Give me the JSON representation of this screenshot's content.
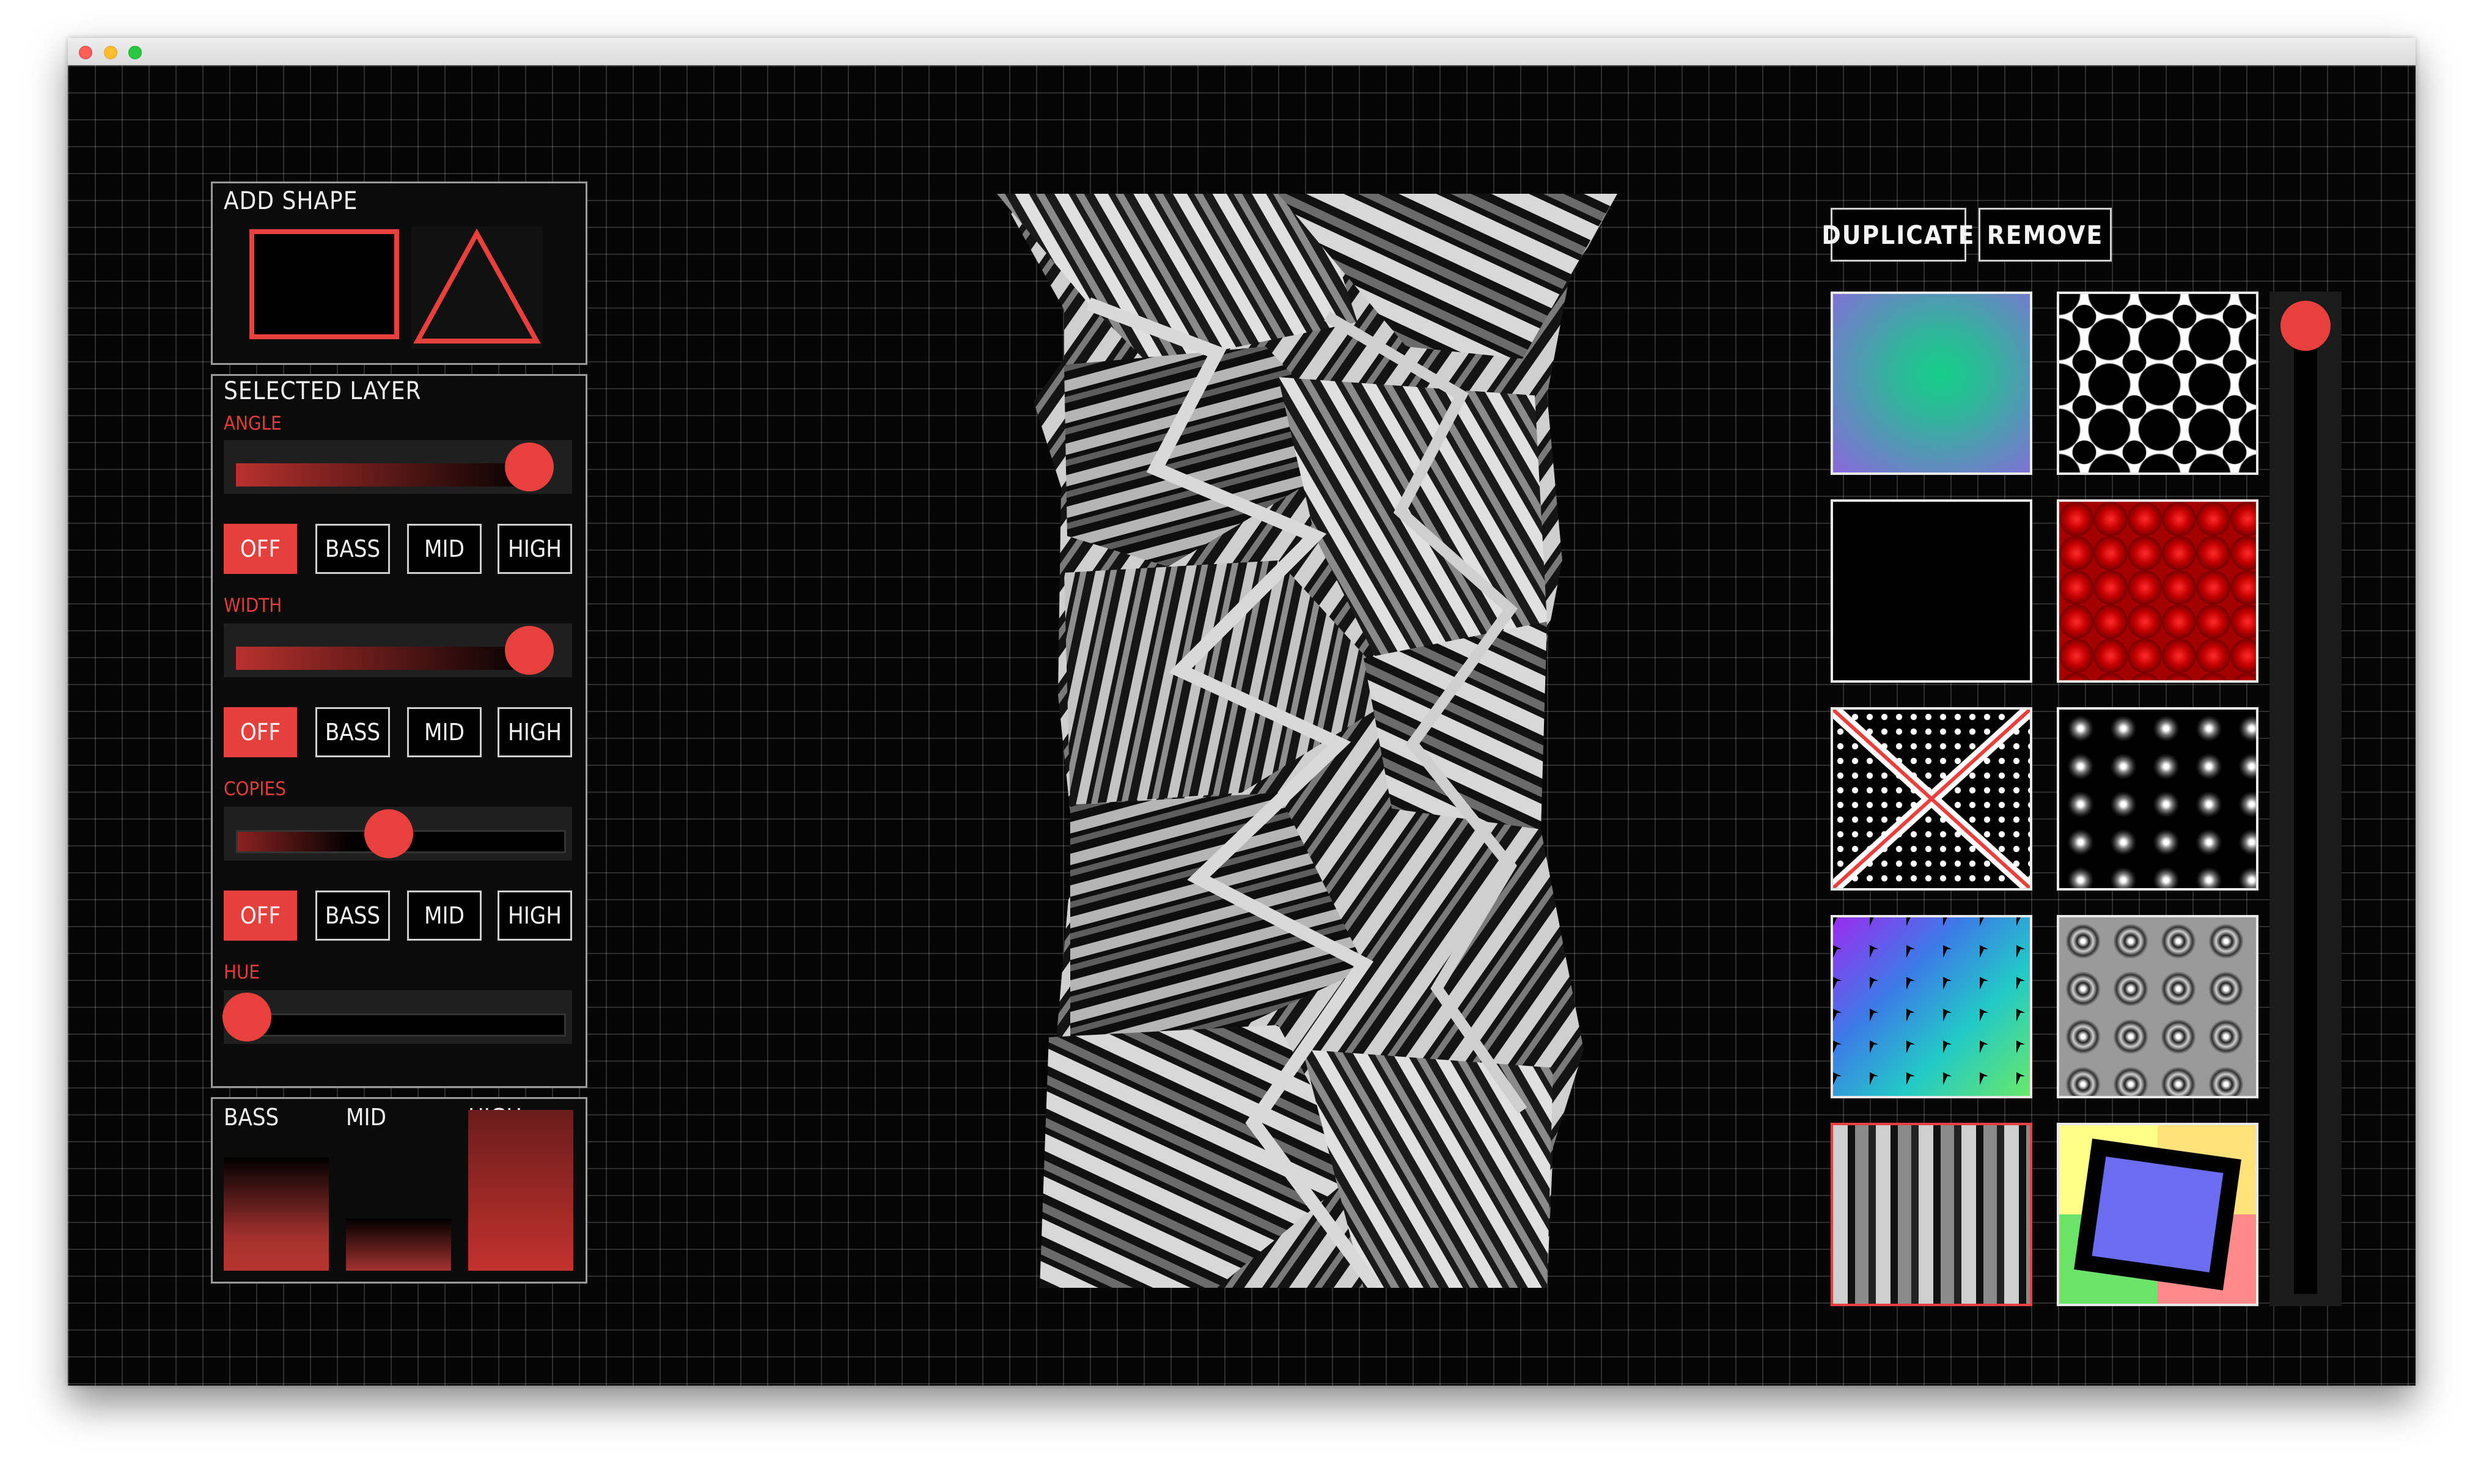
{
  "add_shape": {
    "title": "ADD SHAPE",
    "shapes": [
      "rectangle",
      "triangle"
    ]
  },
  "selected_layer": {
    "title": "SELECTED LAYER",
    "sliders": [
      {
        "label": "ANGLE",
        "value": 0.9
      },
      {
        "label": "WIDTH",
        "value": 0.9
      },
      {
        "label": "COPIES",
        "value": 0.4
      }
    ],
    "hue": {
      "label": "HUE",
      "value": 0.0
    },
    "bands": [
      "OFF",
      "BASS",
      "MID",
      "HIGH"
    ]
  },
  "equalizer": {
    "bands": [
      {
        "label": "BASS",
        "level": 0.7
      },
      {
        "label": "MID",
        "level": 0.32
      },
      {
        "label": "HIGH",
        "level": 0.97
      }
    ]
  },
  "actions": {
    "duplicate": "DUPLICATE",
    "remove": "REMOVE"
  },
  "textures": [
    "gradient-green-purple",
    "quatrefoil-pattern",
    "black",
    "red-dots",
    "x-dot-pattern",
    "kaleidoscope",
    "mosaic-rainbow",
    "swirls",
    "stripes",
    "square-yellow-green"
  ],
  "selected_texture": 8,
  "vertical_slider": {
    "value": 1.0
  },
  "colors": {
    "accent": "#e8403d",
    "background": "#050505",
    "grid": "#3a3a3a"
  }
}
